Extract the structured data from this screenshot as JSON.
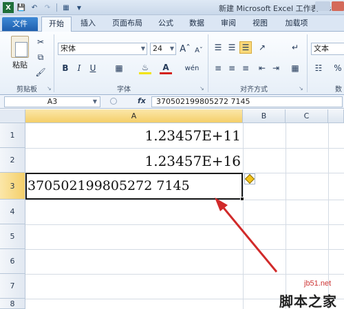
{
  "window": {
    "title": "新建 Microsoft Excel 工作表.xls - Mic"
  },
  "tabs": [
    {
      "label": "文件",
      "active": false
    },
    {
      "label": "开始",
      "active": true
    },
    {
      "label": "插入",
      "active": false
    },
    {
      "label": "页面布局",
      "active": false
    },
    {
      "label": "公式",
      "active": false
    },
    {
      "label": "数据",
      "active": false
    },
    {
      "label": "审阅",
      "active": false
    },
    {
      "label": "视图",
      "active": false
    },
    {
      "label": "加载项",
      "active": false
    }
  ],
  "ribbon": {
    "clipboard": {
      "paste_label": "粘贴",
      "group_label": "剪贴板"
    },
    "font": {
      "font_name": "宋体",
      "font_size": "24",
      "group_label": "字体"
    },
    "alignment": {
      "group_label": "对齐方式"
    },
    "number": {
      "format": "文本",
      "group_label": "数"
    }
  },
  "formula_bar": {
    "name_box": "A3",
    "fx_label": "fx",
    "content": "370502199805272 7145"
  },
  "grid": {
    "columns": [
      "A",
      "B",
      "C"
    ],
    "rows": [
      "1",
      "2",
      "3",
      "4",
      "5",
      "6",
      "7",
      "8"
    ],
    "cells": {
      "A1": "1.23457E+11",
      "A2": "1.23457E+16",
      "A3": "370502199805272 7145"
    },
    "selected_cell": "A3"
  },
  "watermark": {
    "site": "jb51.net",
    "name": "脚本之家"
  },
  "colors": {
    "selection_header": "#f4cf6a",
    "file_tab": "#2a6fbf",
    "arrow": "#d12a2a"
  }
}
